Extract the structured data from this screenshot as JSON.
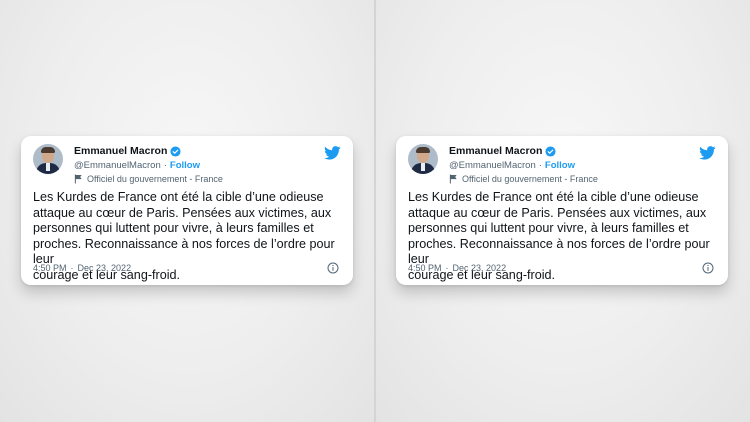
{
  "tweets": [
    {
      "author_name": "Emmanuel Macron",
      "handle": "@EmmanuelMacron",
      "separator": "·",
      "follow_label": "Follow",
      "affiliation": "Officiel du gouvernement - France",
      "text": "Les Kurdes de France ont été la cible d’une odieuse\nattaque au cœur de Paris. Pensées aux victimes, aux\npersonnes qui luttent pour vivre, à leurs familles et\nproches. Reconnaissance à nos forces de l’ordre pour leur\ncourage et leur sang-froid.",
      "time": "4:50 PM",
      "date_separator": "·",
      "date": "Dec 23, 2022"
    },
    {
      "author_name": "Emmanuel Macron",
      "handle": "@EmmanuelMacron",
      "separator": "·",
      "follow_label": "Follow",
      "affiliation": "Officiel du gouvernement - France",
      "text": "Les Kurdes de France ont été la cible d’une odieuse\nattaque au cœur de Paris. Pensées aux victimes, aux\npersonnes qui luttent pour vivre, à leurs familles et\nproches. Reconnaissance à nos forces de l’ordre pour leur\ncourage et leur sang-froid.",
      "time": "4:50 PM",
      "date_separator": "·",
      "date": "Dec 23, 2022"
    }
  ],
  "icons": {
    "verified": "verified-badge-icon",
    "platform": "twitter-bird-icon",
    "affiliation": "flag-icon",
    "info": "info-icon"
  },
  "colors": {
    "accent": "#1d9bf0",
    "text": "#0f1419",
    "secondary": "#536471",
    "background": "#ebebeb"
  }
}
